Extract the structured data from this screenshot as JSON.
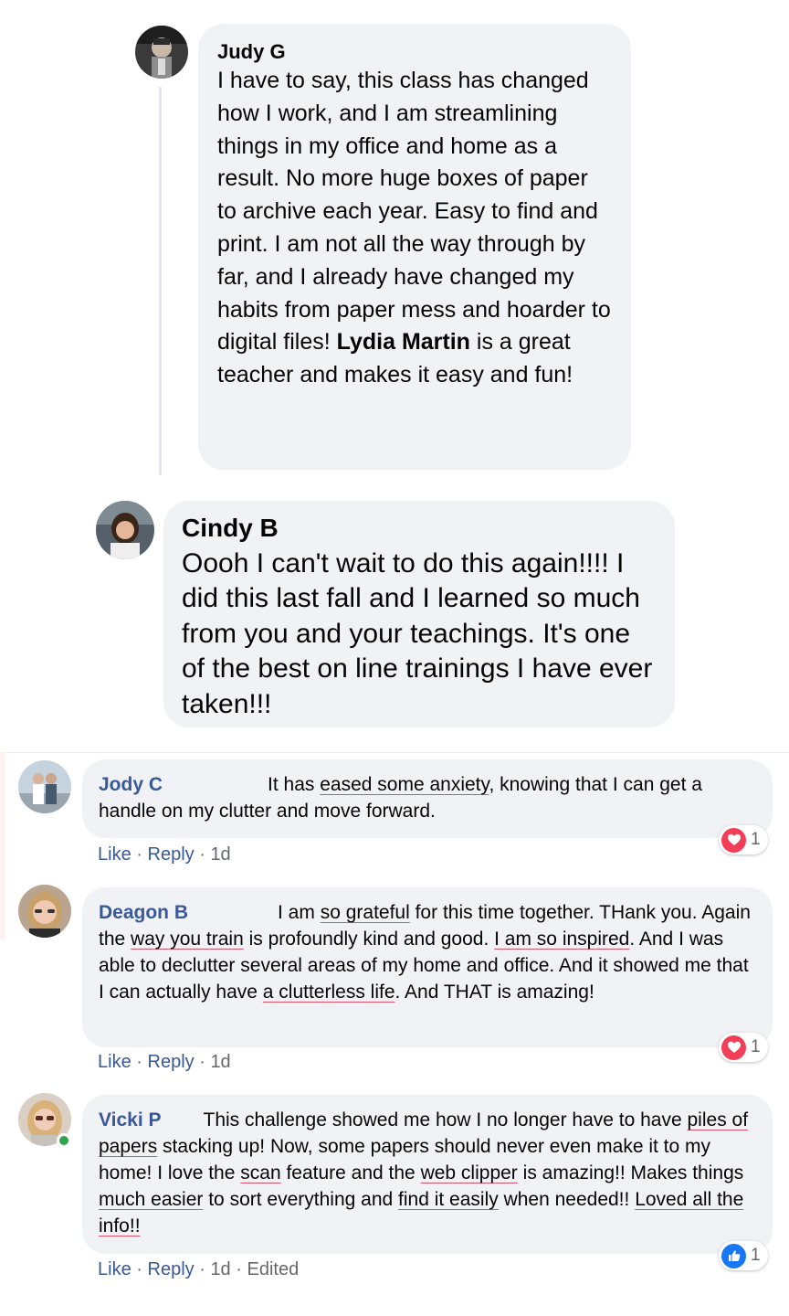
{
  "comments": [
    {
      "author": "Judy G",
      "text_parts": [
        "I have to say, this class has changed how I work, and I am streamlining things in my office and home as a result. No more huge boxes of paper to archive each year. Easy to find and print. I am not all the way through by far, and I already have changed my habits from paper mess and hoarder to digital files! ",
        "Lydia Martin",
        " is a great teacher and makes it easy and fun!"
      ],
      "tagged_name": "Lydia Martin"
    },
    {
      "author": "Cindy B",
      "text": "Oooh I can't wait to do this again!!!! I did this last fall and I learned so much from you and your teachings. It's one of the best on line trainings I have ever taken!!!"
    },
    {
      "author": "Jody C",
      "text_before": "It has ",
      "underline_1": "eased some anxiety",
      "text_after": ", knowing that I can get a handle on my clutter and move forward.",
      "actions": {
        "like": "Like",
        "reply": "Reply",
        "time": "1d"
      },
      "reaction": {
        "type": "love",
        "count": "1",
        "color": "#f33e58"
      }
    },
    {
      "author": "Deagon B",
      "t1": "I am ",
      "u1": "so grateful",
      "t2": " for this time together. THank you. Again the ",
      "u2": "way you train",
      "t3": " is profoundly kind and good. ",
      "u3": "I am so inspired",
      "t4": ". And I was able to declutter several areas of my home and office. And it showed me that I can actually have ",
      "u4": "a clutterless life",
      "t5": ". And THAT is amazing!",
      "actions": {
        "like": "Like",
        "reply": "Reply",
        "time": "1d"
      },
      "reaction": {
        "type": "love",
        "count": "1",
        "color": "#f33e58"
      }
    },
    {
      "author": "Vicki P",
      "t1": "This challenge showed me how I no longer have to have ",
      "u1": "piles of papers",
      "t2": " stacking up! Now, some papers should never even make it to my home! I love the ",
      "u2": "scan",
      "t3": " feature and the ",
      "u3": "web clipper",
      "t4": " is amazing!! Makes things ",
      "u4": "much easier",
      "t5": " to sort everything and ",
      "u5": "find it easily",
      "t6": " when needed!! ",
      "u6": "Loved all the info!!",
      "actions": {
        "like": "Like",
        "reply": "Reply",
        "time": "1d",
        "edited": "Edited"
      },
      "reaction": {
        "type": "like",
        "count": "1",
        "color": "#1877f2"
      }
    }
  ],
  "separator": "·",
  "colors": {
    "bubble": "#f0f2f5",
    "author_link": "#385898",
    "meta": "#65676b",
    "online": "#31a24c",
    "underline": "#d9536d"
  },
  "icons": [
    "heart-icon",
    "thumbs-up-icon"
  ]
}
